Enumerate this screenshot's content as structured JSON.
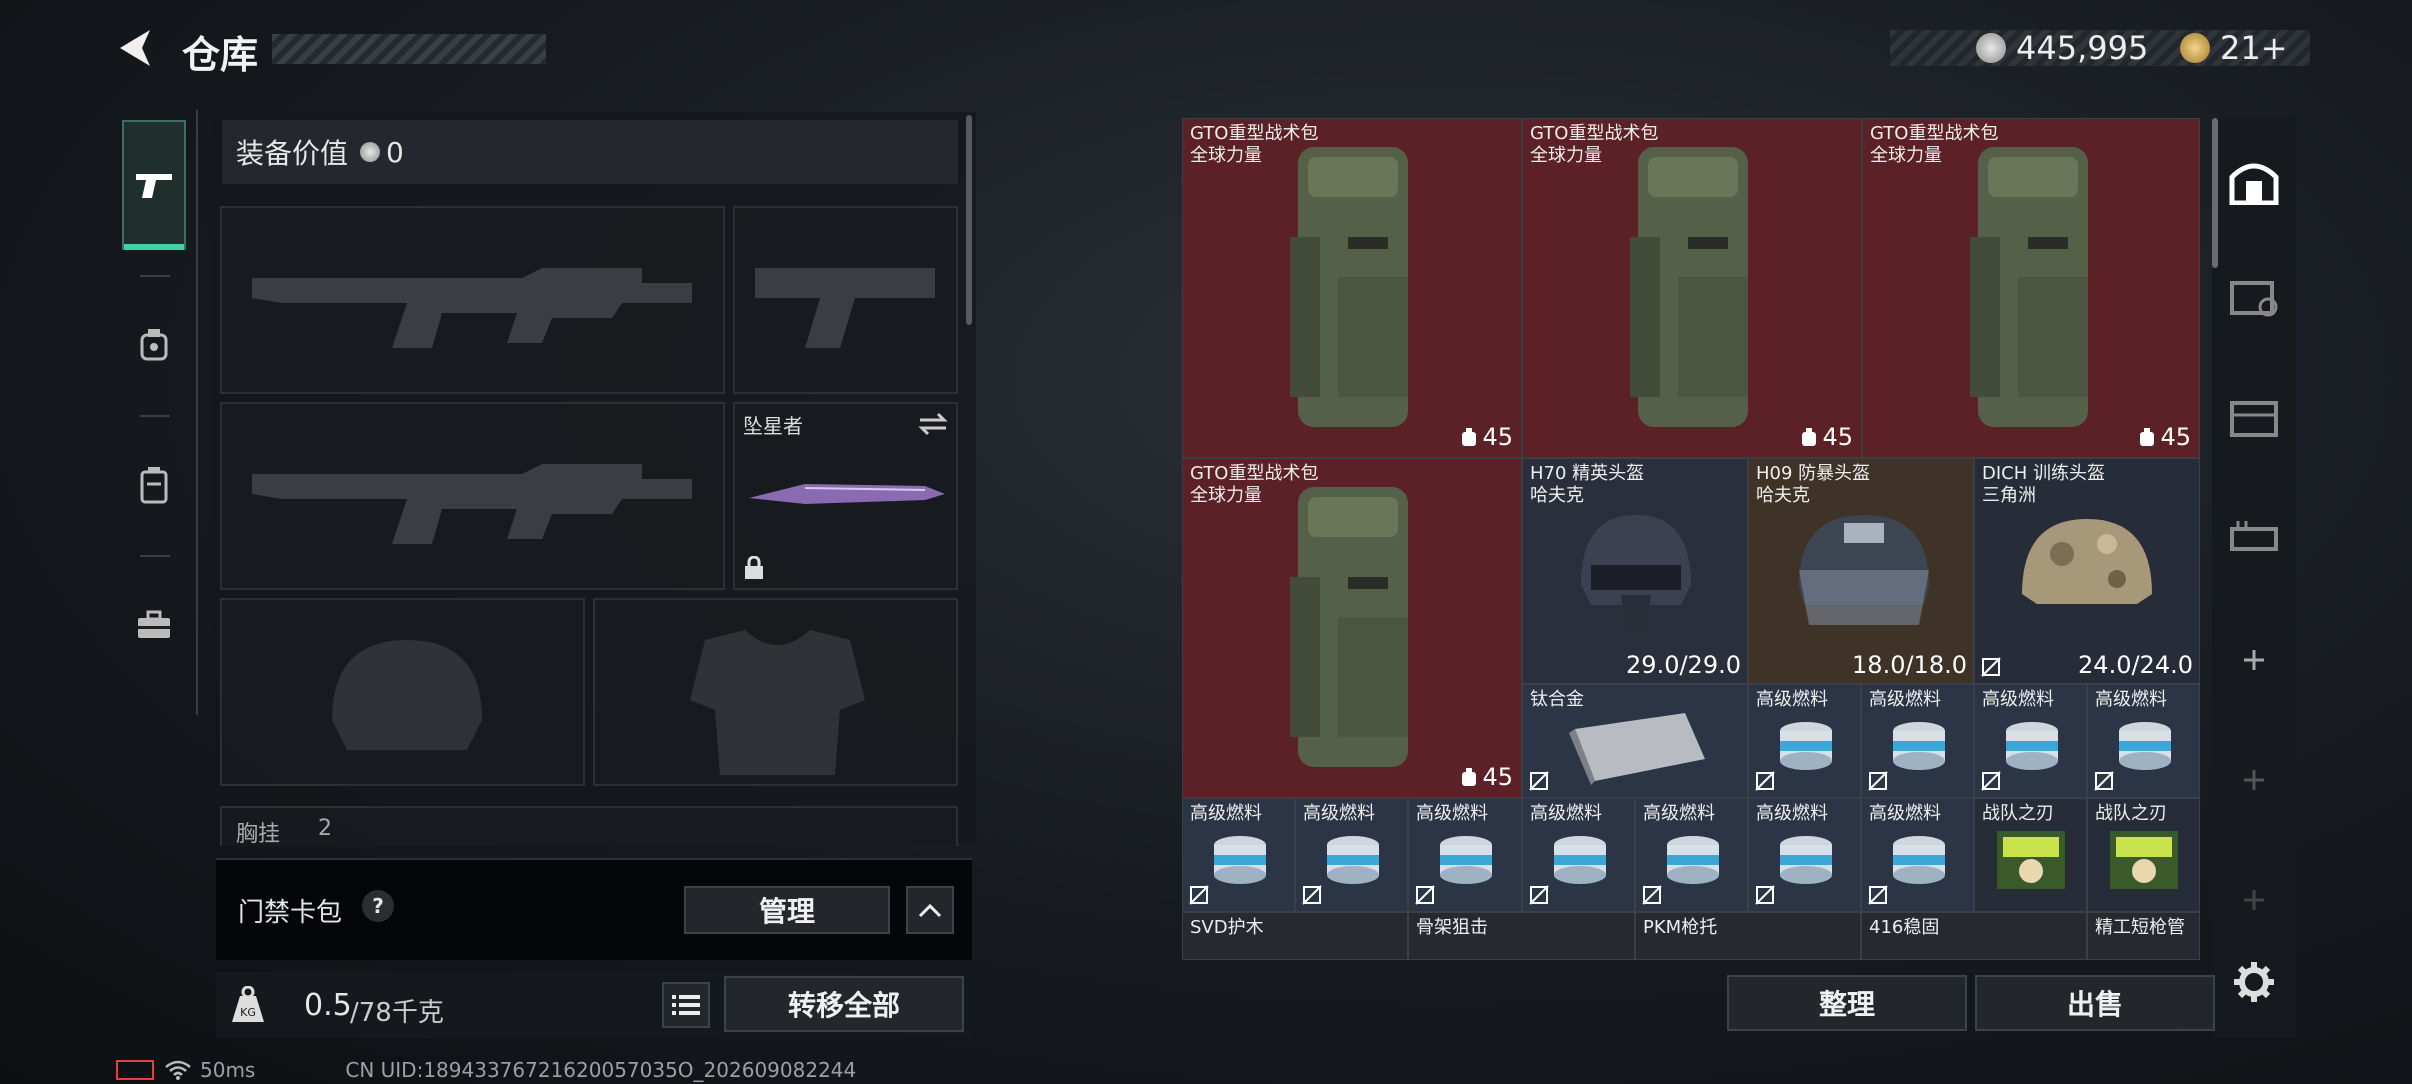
{
  "header": {
    "title": "仓库",
    "currency_primary": "445,995",
    "currency_secondary": "21+"
  },
  "left_panel": {
    "equip_value_label": "装备价值",
    "equip_value": "0",
    "melee_slot_label": "坠星者",
    "chest_label_partial": "胸挂",
    "chest_count_partial": "2",
    "keycard_label": "门禁卡包",
    "keycard_help": "?",
    "manage_button": "管理",
    "weight_value": "0.5",
    "weight_total": "/78千克",
    "transfer_all_button": "转移全部"
  },
  "grid_items": [
    {
      "name": "GTO重型战术包",
      "sub": "全球力量",
      "count": "45"
    },
    {
      "name": "GTO重型战术包",
      "sub": "全球力量",
      "count": "45"
    },
    {
      "name": "GTO重型战术包",
      "sub": "全球力量",
      "count": "45"
    },
    {
      "name": "GTO重型战术包",
      "sub": "全球力量",
      "count": "45"
    },
    {
      "name": "H70 精英头盔",
      "sub": "哈夫克",
      "durability": "29.0/29.0"
    },
    {
      "name": "H09 防暴头盔",
      "sub": "哈夫克",
      "durability": "18.0/18.0"
    },
    {
      "name": "DICH 训练头盔",
      "sub": "三角洲",
      "durability": "24.0/24.0"
    },
    {
      "name": "钛合金"
    },
    {
      "name": "高级燃料"
    },
    {
      "name": "战队之刃"
    },
    {
      "name": "SVD护木"
    },
    {
      "name": "骨架狙击"
    },
    {
      "name": "PKM枪托"
    },
    {
      "name": "416稳固"
    },
    {
      "name": "精工短枪管"
    }
  ],
  "bottom_buttons": {
    "sort": "整理",
    "sell": "出售"
  },
  "status_bar": {
    "ping": "50ms",
    "uid": "CN UID:18943376721620057035O_202609082244"
  },
  "colors": {
    "accent": "#3fd0a6",
    "red_cell": "#5c2127",
    "helmet_cell": "#2b2f3b"
  }
}
